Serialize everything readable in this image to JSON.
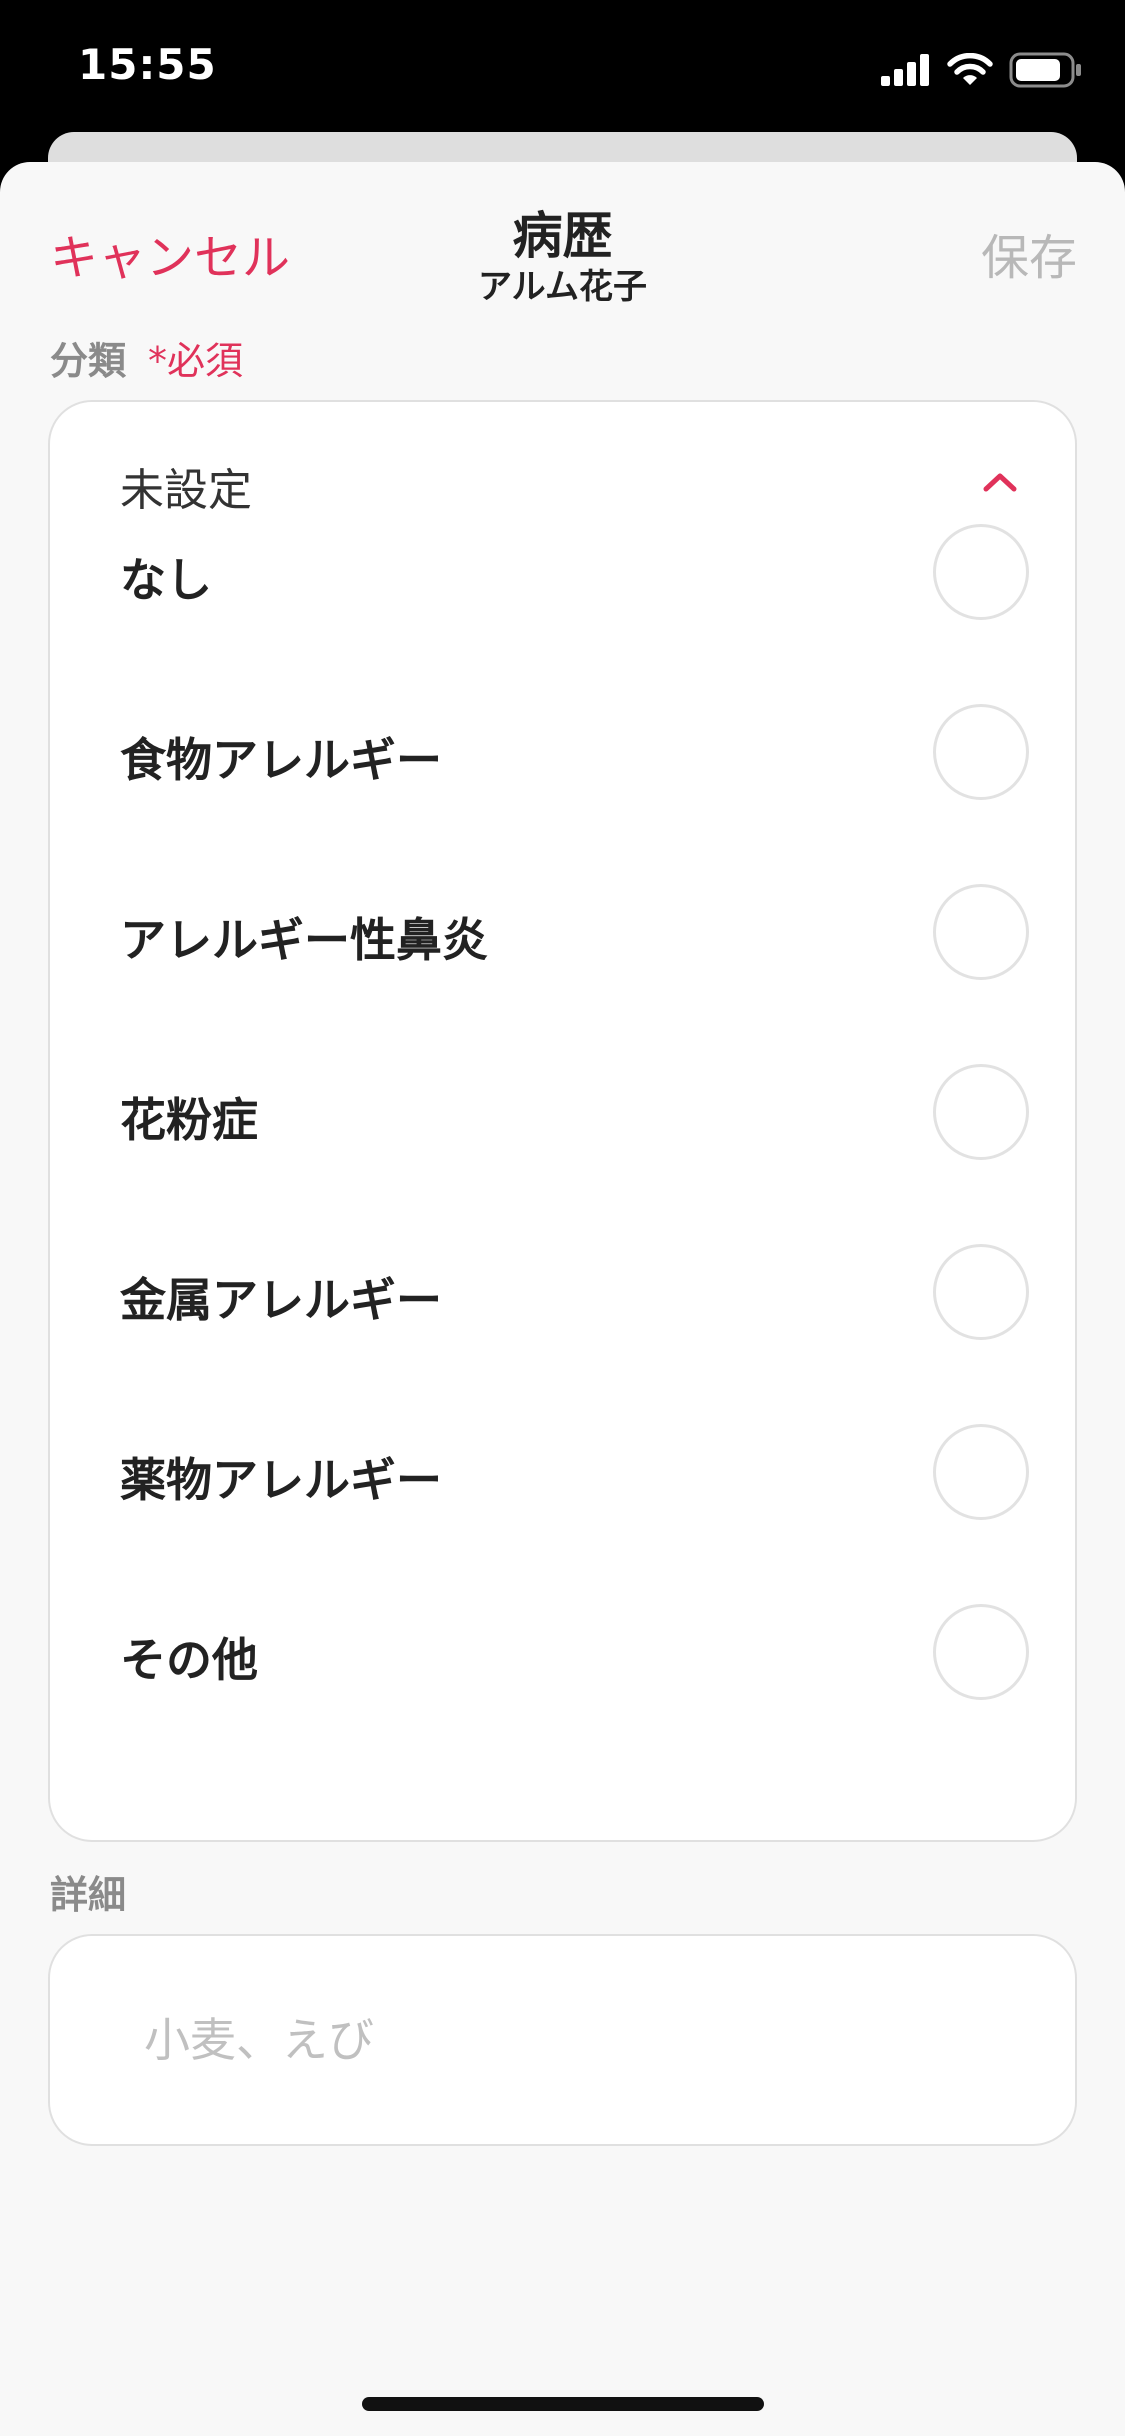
{
  "status_bar": {
    "time": "15:55",
    "icons": [
      "cellular-signal-icon",
      "wifi-icon",
      "battery-icon"
    ]
  },
  "nav": {
    "cancel_label": "キャンセル",
    "title": "病歴",
    "subtitle": "アルム花子",
    "save_label": "保存"
  },
  "category": {
    "label": "分類",
    "required_label": "*必須",
    "selected_value": "未設定",
    "expanded": true,
    "options": [
      {
        "label": "なし",
        "selected": false
      },
      {
        "label": "食物アレルギー",
        "selected": false
      },
      {
        "label": "アレルギー性鼻炎",
        "selected": false
      },
      {
        "label": "花粉症",
        "selected": false
      },
      {
        "label": "金属アレルギー",
        "selected": false
      },
      {
        "label": "薬物アレルギー",
        "selected": false
      },
      {
        "label": "その他",
        "selected": false
      }
    ]
  },
  "detail": {
    "label": "詳細",
    "value": "",
    "placeholder": "小麦、えび"
  },
  "colors": {
    "accent": "#e0325a",
    "disabled_text": "#b8b8b8",
    "sheet_background": "#f8f8f8",
    "card_background": "#ffffff"
  }
}
